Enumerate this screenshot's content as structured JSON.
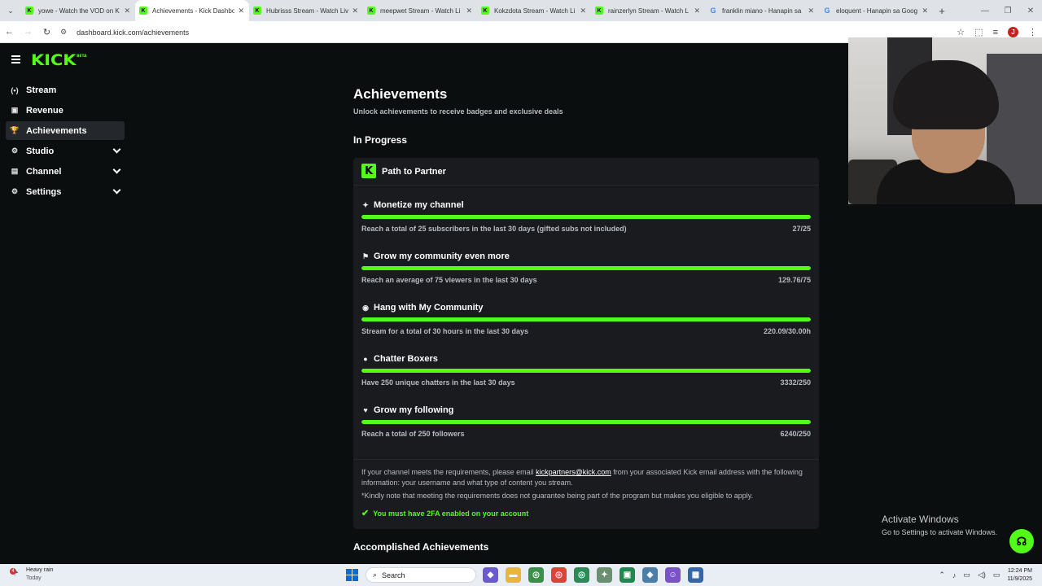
{
  "browser": {
    "tabs": [
      {
        "title": "yowe - Watch the VOD on K",
        "fav": "K",
        "kind": "kick",
        "active": false
      },
      {
        "title": "Achievements - Kick Dashbo",
        "fav": "K",
        "kind": "kick",
        "active": true
      },
      {
        "title": "Hubrisss Stream - Watch Liv",
        "fav": "K",
        "kind": "kick",
        "active": false
      },
      {
        "title": "meepwet Stream - Watch Li",
        "fav": "K",
        "kind": "kick",
        "active": false
      },
      {
        "title": "Kokzdota Stream - Watch Li",
        "fav": "K",
        "kind": "kick",
        "active": false
      },
      {
        "title": "rainzerlyn Stream - Watch L",
        "fav": "K",
        "kind": "kick",
        "active": false
      },
      {
        "title": "franklin miano - Hanapin sa",
        "fav": "G",
        "kind": "goog",
        "active": false
      },
      {
        "title": "eloquent - Hanapin sa Goog",
        "fav": "G",
        "kind": "goog",
        "active": false
      }
    ],
    "url": "dashboard.kick.com/achievements",
    "profile_initial": "J"
  },
  "app": {
    "logo": "KICK",
    "logo_badge": "BETA",
    "sidebar": [
      {
        "label": "Stream",
        "icon": "(•)",
        "name": "stream",
        "active": false,
        "expandable": false
      },
      {
        "label": "Revenue",
        "icon": "▣",
        "name": "revenue",
        "active": false,
        "expandable": false
      },
      {
        "label": "Achievements",
        "icon": "🏆",
        "name": "achievements",
        "active": true,
        "expandable": false
      },
      {
        "label": "Studio",
        "icon": "⚙",
        "name": "studio",
        "active": false,
        "expandable": true
      },
      {
        "label": "Channel",
        "icon": "▤",
        "name": "channel",
        "active": false,
        "expandable": true
      },
      {
        "label": "Settings",
        "icon": "⚙",
        "name": "settings",
        "active": false,
        "expandable": true
      }
    ],
    "page_title": "Achievements",
    "page_subtitle": "Unlock achievements to receive badges and exclusive deals",
    "in_progress_title": "In Progress",
    "card_title": "Path to Partner",
    "achievements": [
      {
        "title": "Monetize my channel",
        "icon": "✦",
        "desc": "Reach a total of 25 subscribers in the last 30 days (gifted subs not included)",
        "value": "27/25",
        "progress": 1.0
      },
      {
        "title": "Grow my community even more",
        "icon": "⚑",
        "desc": "Reach an average of 75 viewers in the last 30 days",
        "value": "129.76/75",
        "progress": 1.0
      },
      {
        "title": "Hang with My Community",
        "icon": "◉",
        "desc": "Stream for a total of 30 hours in the last 30 days",
        "value": "220.09/30.00h",
        "progress": 1.0
      },
      {
        "title": "Chatter Boxers",
        "icon": "●",
        "desc": "Have 250 unique chatters in the last 30 days",
        "value": "3332/250",
        "progress": 1.0
      },
      {
        "title": "Grow my following",
        "icon": "♥",
        "desc": "Reach a total of 250 followers",
        "value": "6240/250",
        "progress": 1.0
      }
    ],
    "note_prefix": "If your channel meets the requirements, please email ",
    "note_email": "kickpartners@kick.com",
    "note_suffix": " from your associated Kick email address with the following information: your username and what type of content you stream.",
    "note2": "*Kindly note that meeting the requirements does not guarantee being part of the program but makes you eligible to apply.",
    "twofa": "You must have 2FA enabled on your account",
    "accomplished_title": "Accomplished Achievements"
  },
  "overlay": {
    "activate_title": "Activate Windows",
    "activate_sub": "Go to Settings to activate Windows."
  },
  "taskbar": {
    "weather_badge": "4",
    "weather_title": "Heavy rain",
    "weather_sub": "Today",
    "search_placeholder": "Search",
    "time": "12:24 PM",
    "date": "11/9/2025"
  },
  "colors": {
    "accent": "#53fc18",
    "card_bg": "#191b1f",
    "page_bg": "#0b0e0f",
    "muted_text": "#b6bcc2"
  }
}
